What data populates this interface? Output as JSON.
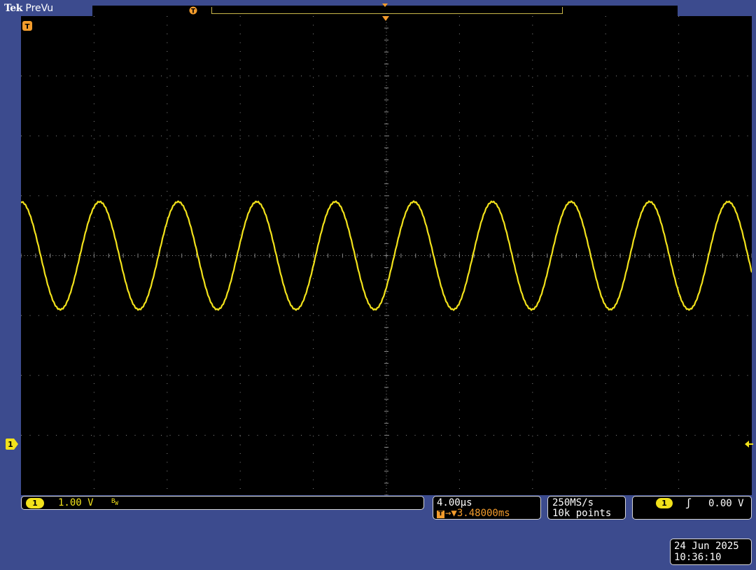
{
  "header": {
    "brand": "Tek",
    "mode": "PreVu",
    "record_trigger_glyph": "T"
  },
  "screen": {
    "trigger_marker_glyph": "T",
    "channel_marker_glyph": "1",
    "trace_color": "#f2e21b",
    "grid_color": "#8a8a8a",
    "divisions": {
      "horizontal": 10,
      "vertical": 8
    }
  },
  "waveform": {
    "shape": "sine",
    "cycles_visible": 9.3,
    "amplitude_divisions": 1.8,
    "offset_divisions": 0.4,
    "phase_at_left": 0.5
  },
  "channel1": {
    "badge": "1",
    "scale": "1.00 V",
    "bw_icon": "B",
    "bw_sub": "W"
  },
  "timebase": {
    "scale": "4.00µs",
    "trigger_glyph": "T",
    "delay": "→▼3.48000ms"
  },
  "acquisition": {
    "rate": "250MS/s",
    "points": "10k points"
  },
  "trigger": {
    "source_badge": "1",
    "slope_icon": "rising-edge-icon",
    "slope_glyph": "ʃ",
    "level": "0.00 V"
  },
  "datetime": {
    "date": "24 Jun  2025",
    "time": "10:36:10"
  },
  "colors": {
    "frame_blue": "#3c4b8e",
    "trace_yellow": "#f2e21b",
    "trigger_orange": "#f39c2c"
  }
}
